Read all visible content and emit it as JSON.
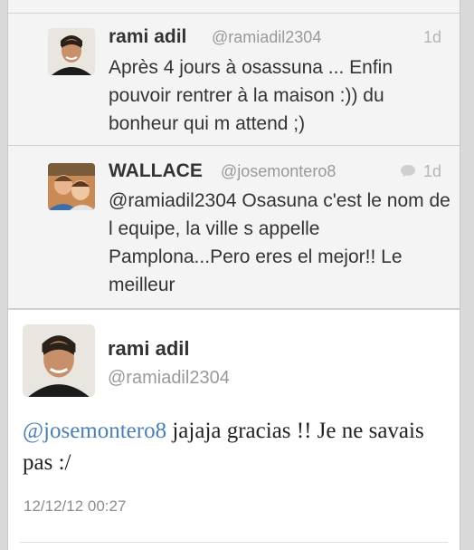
{
  "tweets": [
    {
      "name": "rami adil",
      "handle": "@ramiadil2304",
      "time": "1d",
      "text": "Après 4 jours à osassuna ... Enfin pouvoir rentrer à la maison :)) du bonheur qui m attend ;)",
      "avatar_icon": "man-portrait-avatar"
    },
    {
      "name": "WALLACE",
      "handle": "@josemontero8",
      "time": "1d",
      "text": "@ramiadil2304 Osasuna c'est le nom de l equipe, la ville s appelle Pamplona...Pero eres el mejor!! Le meilleur",
      "avatar_icon": "children-photo-avatar",
      "status_icon": "conversation-icon"
    }
  ],
  "detail": {
    "name": "rami adil",
    "handle": "@ramiadil2304",
    "mention": "@josemontero8",
    "text": " jajaja gracias !! Je ne savais pas :/",
    "timestamp": "12/12/12 00:27",
    "avatar_icon": "man-portrait-avatar"
  },
  "colors": {
    "mention": "#4a7fb5",
    "background": "#f4f4f4",
    "detail_background": "#ffffff"
  }
}
